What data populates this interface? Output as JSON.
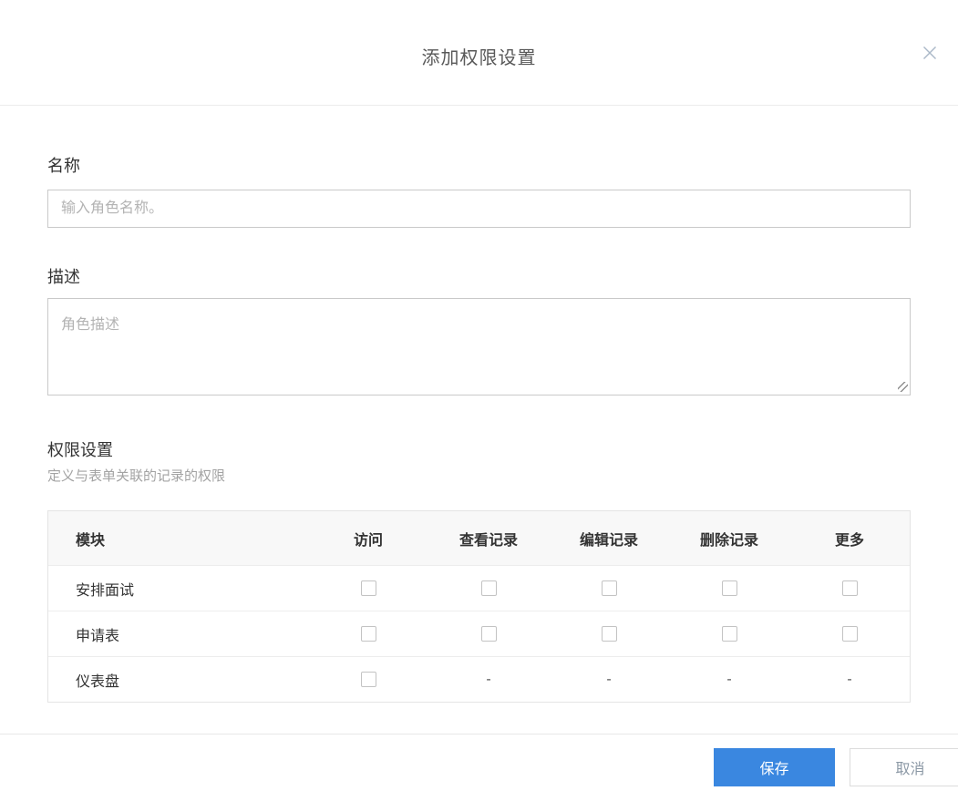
{
  "modal": {
    "title": "添加权限设置",
    "close_icon": "x"
  },
  "form": {
    "name_label": "名称",
    "name_value": "",
    "name_placeholder": "输入角色名称。",
    "description_label": "描述",
    "description_value": "",
    "description_placeholder": "角色描述"
  },
  "permissions": {
    "section_title": "权限设置",
    "section_subtitle": "定义与表单关联的记录的权限",
    "table": {
      "headers": [
        "模块",
        "访问",
        "查看记录",
        "编辑记录",
        "删除记录",
        "更多"
      ],
      "rows": [
        {
          "module": "安排面试",
          "cells": [
            "checkbox",
            "checkbox",
            "checkbox",
            "checkbox",
            "checkbox"
          ],
          "checked": [
            false,
            false,
            false,
            false,
            false
          ]
        },
        {
          "module": "申请表",
          "cells": [
            "checkbox",
            "checkbox",
            "checkbox",
            "checkbox",
            "checkbox"
          ],
          "checked": [
            false,
            false,
            false,
            false,
            false
          ]
        },
        {
          "module": "仪表盘",
          "cells": [
            "checkbox",
            "-",
            "-",
            "-",
            "-"
          ],
          "checked": [
            false
          ]
        }
      ]
    }
  },
  "footer": {
    "save_label": "保存",
    "cancel_label": "取消"
  },
  "colors": {
    "primary_blue": "#3a87e0",
    "input_border": "#c9c9c9",
    "table_border": "#e4e4e4",
    "table_header_bg": "#f8f8f8",
    "title_text": "#595959",
    "subtitle_text": "#a3a3a3",
    "cancel_text": "#8b98a5"
  }
}
